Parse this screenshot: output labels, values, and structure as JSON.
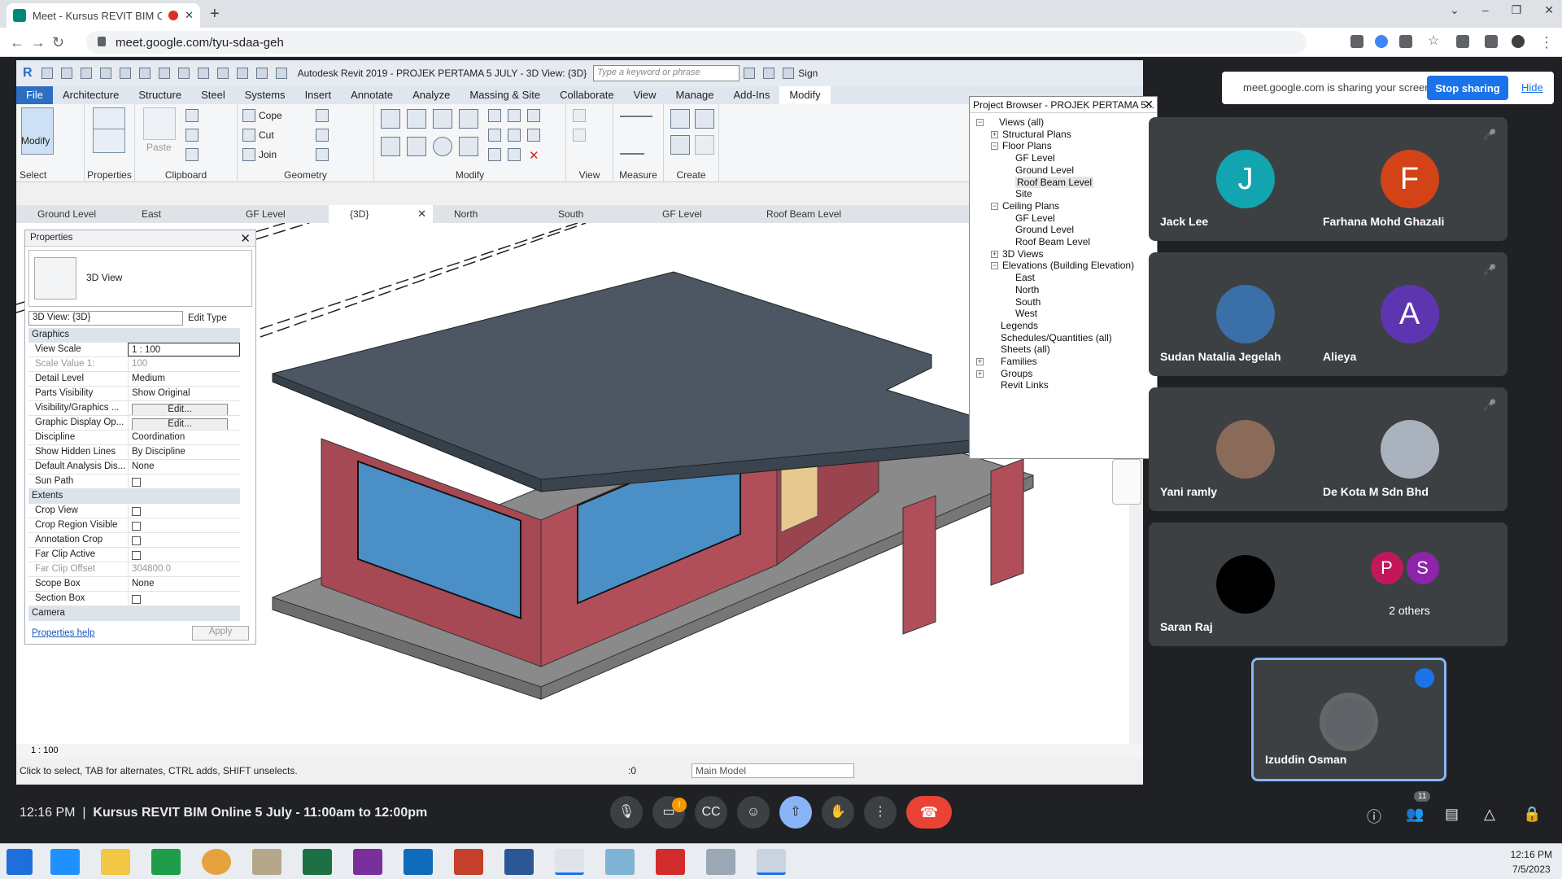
{
  "browser": {
    "tab_title": "Meet - Kursus REVIT BIM Online",
    "url": "meet.google.com/tyu-sdaa-geh"
  },
  "revit": {
    "app_title": "Autodesk Revit 2019 - PROJEK PERTAMA 5 JULY - 3D View: {3D}",
    "search_placeholder": "Type a keyword or phrase",
    "sign_in": "Sign",
    "menu": [
      "File",
      "Architecture",
      "Structure",
      "Steel",
      "Systems",
      "Insert",
      "Annotate",
      "Analyze",
      "Massing & Site",
      "Collaborate",
      "View",
      "Manage",
      "Add-Ins",
      "Modify"
    ],
    "ribbon": {
      "modify": "Modify",
      "select": "Select",
      "properties": "Properties",
      "paste": "Paste",
      "clipboard": "Clipboard",
      "cope": "Cope",
      "cut": "Cut",
      "join": "Join",
      "geometry": "Geometry",
      "modify_group": "Modify",
      "view": "View",
      "measure": "Measure",
      "create": "Create"
    },
    "view_tabs": [
      "Ground Level",
      "East",
      "GF Level",
      "{3D}",
      "North",
      "South",
      "GF Level",
      "Roof Beam Level"
    ],
    "properties": {
      "title": "Properties",
      "type_name": "3D View",
      "selector": "3D View: {3D}",
      "edit_type": "Edit Type",
      "graphics_section": "Graphics",
      "rows": [
        {
          "k": "View Scale",
          "v": "1 : 100"
        },
        {
          "k": "Scale Value    1:",
          "v": "100"
        },
        {
          "k": "Detail Level",
          "v": "Medium"
        },
        {
          "k": "Parts Visibility",
          "v": "Show Original"
        },
        {
          "k": "Visibility/Graphics ...",
          "v": "Edit..."
        },
        {
          "k": "Graphic Display Op...",
          "v": "Edit..."
        },
        {
          "k": "Discipline",
          "v": "Coordination"
        },
        {
          "k": "Show Hidden Lines",
          "v": "By Discipline"
        },
        {
          "k": "Default Analysis Dis...",
          "v": "None"
        },
        {
          "k": "Sun Path",
          "v": ""
        }
      ],
      "extents_section": "Extents",
      "extents_rows": [
        {
          "k": "Crop View",
          "v": ""
        },
        {
          "k": "Crop Region Visible",
          "v": ""
        },
        {
          "k": "Annotation Crop",
          "v": ""
        },
        {
          "k": "Far Clip Active",
          "v": ""
        },
        {
          "k": "Far Clip Offset",
          "v": "304800.0"
        },
        {
          "k": "Scope Box",
          "v": "None"
        },
        {
          "k": "Section Box",
          "v": ""
        }
      ],
      "camera_section": "Camera",
      "help": "Properties help",
      "apply": "Apply"
    },
    "project_browser": {
      "title": "Project Browser - PROJEK PERTAMA 5...",
      "items": [
        "Views (all)",
        "Structural Plans",
        "Floor Plans",
        "GF Level",
        "Ground Level",
        "Roof Beam Level",
        "Site",
        "Ceiling Plans",
        "GF Level",
        "Ground Level",
        "Roof Beam Level",
        "3D Views",
        "Elevations (Building Elevation)",
        "East",
        "North",
        "South",
        "West",
        "Legends",
        "Schedules/Quantities (all)",
        "Sheets (all)",
        "Families",
        "Groups",
        "Revit Links"
      ]
    },
    "scale": "1 : 100",
    "status_text": "Click to select, TAB for alternates, CTRL adds, SHIFT unselects.",
    "selection_count": ":0",
    "model": "Main Model"
  },
  "meet": {
    "sharing_text": "meet.google.com is sharing your screen.",
    "stop_sharing": "Stop sharing",
    "hide": "Hide",
    "participants": [
      {
        "name": "Jack Lee",
        "initial": "J",
        "color": "#12a4af"
      },
      {
        "name": "Farhana Mohd Ghazali",
        "initial": "F",
        "color": "#d24318"
      },
      {
        "name": "Sudan Natalia Jegelah",
        "initial": "",
        "color": "#3a6fa8"
      },
      {
        "name": "Alieya",
        "initial": "A",
        "color": "#5e35b1"
      },
      {
        "name": "Yani ramly",
        "initial": "",
        "color": "#8a6b5a"
      },
      {
        "name": "De Kota M Sdn Bhd",
        "initial": "",
        "color": "#aab3bd"
      },
      {
        "name": "Saran Raj",
        "initial": "",
        "color": "#000000"
      }
    ],
    "others": {
      "label": "2 others",
      "a": "P",
      "b": "S"
    },
    "self_name": "Izuddin Osman",
    "meeting_time": "12:16 PM",
    "meeting_title": "Kursus REVIT BIM Online 5 July - 11:00am to 12:00pm",
    "people_count": "11",
    "notify_badge": "!"
  },
  "taskbar": {
    "time": "12:16 PM",
    "date": "7/5/2023"
  }
}
